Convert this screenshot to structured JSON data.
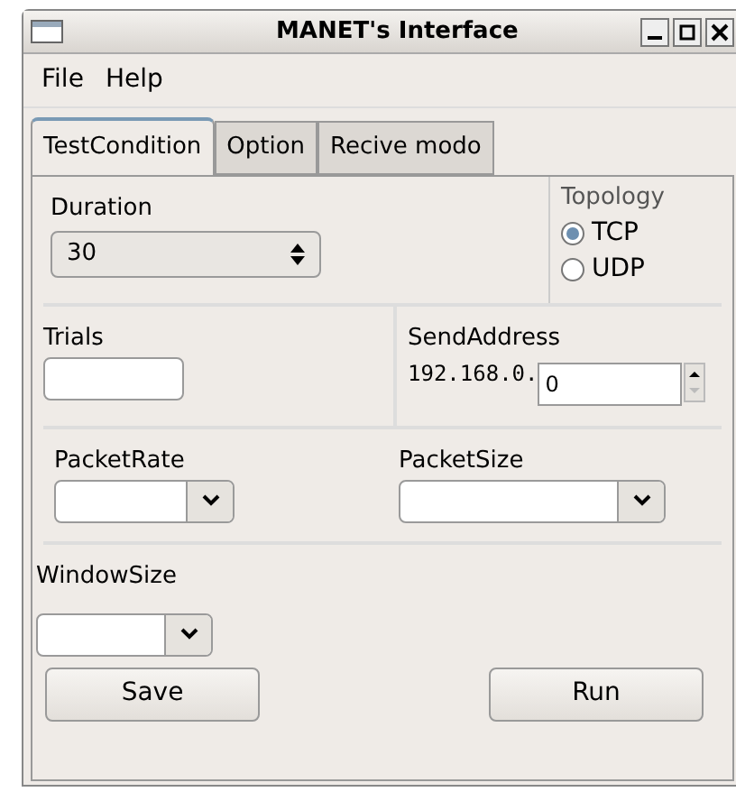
{
  "window": {
    "title": "MANET's Interface"
  },
  "menu": [
    "File",
    "Help"
  ],
  "tabs": [
    {
      "label": "TestCondition",
      "selected": true
    },
    {
      "label": "Option",
      "selected": false
    },
    {
      "label": "Recive modo",
      "selected": false
    }
  ],
  "duration": {
    "label": "Duration",
    "value": "30"
  },
  "topology": {
    "label": "Topology",
    "options": [
      {
        "label": "TCP",
        "selected": true
      },
      {
        "label": "UDP",
        "selected": false
      }
    ]
  },
  "trials": {
    "label": "Trials"
  },
  "send_address": {
    "label": "SendAddress",
    "prefix": "192.168.0.",
    "value": "0"
  },
  "packet_rate": {
    "label": "PacketRate"
  },
  "packet_size": {
    "label": "PacketSize"
  },
  "window_size": {
    "label": "WindowSize"
  },
  "buttons": [
    "Save",
    "Run"
  ]
}
